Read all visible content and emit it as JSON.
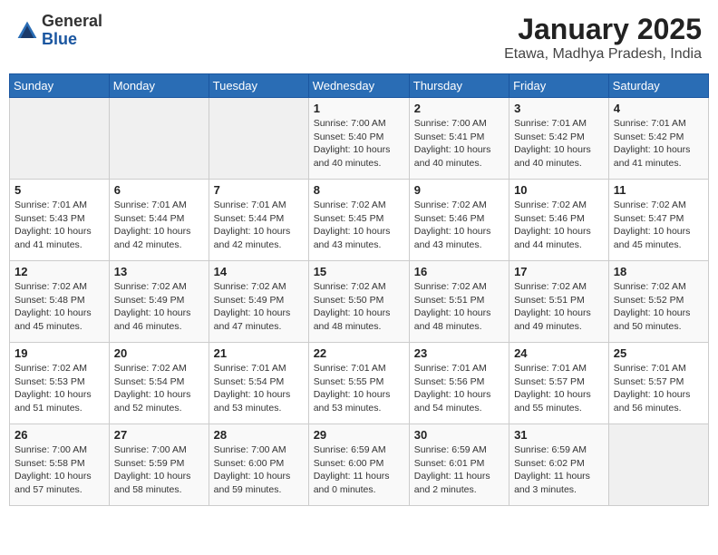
{
  "header": {
    "logo": {
      "general": "General",
      "blue": "Blue"
    },
    "title": "January 2025",
    "location": "Etawa, Madhya Pradesh, India"
  },
  "days_of_week": [
    "Sunday",
    "Monday",
    "Tuesday",
    "Wednesday",
    "Thursday",
    "Friday",
    "Saturday"
  ],
  "weeks": [
    [
      {
        "day": "",
        "sunrise": "",
        "sunset": "",
        "daylight": ""
      },
      {
        "day": "",
        "sunrise": "",
        "sunset": "",
        "daylight": ""
      },
      {
        "day": "",
        "sunrise": "",
        "sunset": "",
        "daylight": ""
      },
      {
        "day": "1",
        "sunrise": "7:00 AM",
        "sunset": "5:40 PM",
        "daylight": "10 hours and 40 minutes."
      },
      {
        "day": "2",
        "sunrise": "7:00 AM",
        "sunset": "5:41 PM",
        "daylight": "10 hours and 40 minutes."
      },
      {
        "day": "3",
        "sunrise": "7:01 AM",
        "sunset": "5:42 PM",
        "daylight": "10 hours and 40 minutes."
      },
      {
        "day": "4",
        "sunrise": "7:01 AM",
        "sunset": "5:42 PM",
        "daylight": "10 hours and 41 minutes."
      }
    ],
    [
      {
        "day": "5",
        "sunrise": "7:01 AM",
        "sunset": "5:43 PM",
        "daylight": "10 hours and 41 minutes."
      },
      {
        "day": "6",
        "sunrise": "7:01 AM",
        "sunset": "5:44 PM",
        "daylight": "10 hours and 42 minutes."
      },
      {
        "day": "7",
        "sunrise": "7:01 AM",
        "sunset": "5:44 PM",
        "daylight": "10 hours and 42 minutes."
      },
      {
        "day": "8",
        "sunrise": "7:02 AM",
        "sunset": "5:45 PM",
        "daylight": "10 hours and 43 minutes."
      },
      {
        "day": "9",
        "sunrise": "7:02 AM",
        "sunset": "5:46 PM",
        "daylight": "10 hours and 43 minutes."
      },
      {
        "day": "10",
        "sunrise": "7:02 AM",
        "sunset": "5:46 PM",
        "daylight": "10 hours and 44 minutes."
      },
      {
        "day": "11",
        "sunrise": "7:02 AM",
        "sunset": "5:47 PM",
        "daylight": "10 hours and 45 minutes."
      }
    ],
    [
      {
        "day": "12",
        "sunrise": "7:02 AM",
        "sunset": "5:48 PM",
        "daylight": "10 hours and 45 minutes."
      },
      {
        "day": "13",
        "sunrise": "7:02 AM",
        "sunset": "5:49 PM",
        "daylight": "10 hours and 46 minutes."
      },
      {
        "day": "14",
        "sunrise": "7:02 AM",
        "sunset": "5:49 PM",
        "daylight": "10 hours and 47 minutes."
      },
      {
        "day": "15",
        "sunrise": "7:02 AM",
        "sunset": "5:50 PM",
        "daylight": "10 hours and 48 minutes."
      },
      {
        "day": "16",
        "sunrise": "7:02 AM",
        "sunset": "5:51 PM",
        "daylight": "10 hours and 48 minutes."
      },
      {
        "day": "17",
        "sunrise": "7:02 AM",
        "sunset": "5:51 PM",
        "daylight": "10 hours and 49 minutes."
      },
      {
        "day": "18",
        "sunrise": "7:02 AM",
        "sunset": "5:52 PM",
        "daylight": "10 hours and 50 minutes."
      }
    ],
    [
      {
        "day": "19",
        "sunrise": "7:02 AM",
        "sunset": "5:53 PM",
        "daylight": "10 hours and 51 minutes."
      },
      {
        "day": "20",
        "sunrise": "7:02 AM",
        "sunset": "5:54 PM",
        "daylight": "10 hours and 52 minutes."
      },
      {
        "day": "21",
        "sunrise": "7:01 AM",
        "sunset": "5:54 PM",
        "daylight": "10 hours and 53 minutes."
      },
      {
        "day": "22",
        "sunrise": "7:01 AM",
        "sunset": "5:55 PM",
        "daylight": "10 hours and 53 minutes."
      },
      {
        "day": "23",
        "sunrise": "7:01 AM",
        "sunset": "5:56 PM",
        "daylight": "10 hours and 54 minutes."
      },
      {
        "day": "24",
        "sunrise": "7:01 AM",
        "sunset": "5:57 PM",
        "daylight": "10 hours and 55 minutes."
      },
      {
        "day": "25",
        "sunrise": "7:01 AM",
        "sunset": "5:57 PM",
        "daylight": "10 hours and 56 minutes."
      }
    ],
    [
      {
        "day": "26",
        "sunrise": "7:00 AM",
        "sunset": "5:58 PM",
        "daylight": "10 hours and 57 minutes."
      },
      {
        "day": "27",
        "sunrise": "7:00 AM",
        "sunset": "5:59 PM",
        "daylight": "10 hours and 58 minutes."
      },
      {
        "day": "28",
        "sunrise": "7:00 AM",
        "sunset": "6:00 PM",
        "daylight": "10 hours and 59 minutes."
      },
      {
        "day": "29",
        "sunrise": "6:59 AM",
        "sunset": "6:00 PM",
        "daylight": "11 hours and 0 minutes."
      },
      {
        "day": "30",
        "sunrise": "6:59 AM",
        "sunset": "6:01 PM",
        "daylight": "11 hours and 2 minutes."
      },
      {
        "day": "31",
        "sunrise": "6:59 AM",
        "sunset": "6:02 PM",
        "daylight": "11 hours and 3 minutes."
      },
      {
        "day": "",
        "sunrise": "",
        "sunset": "",
        "daylight": ""
      }
    ]
  ]
}
